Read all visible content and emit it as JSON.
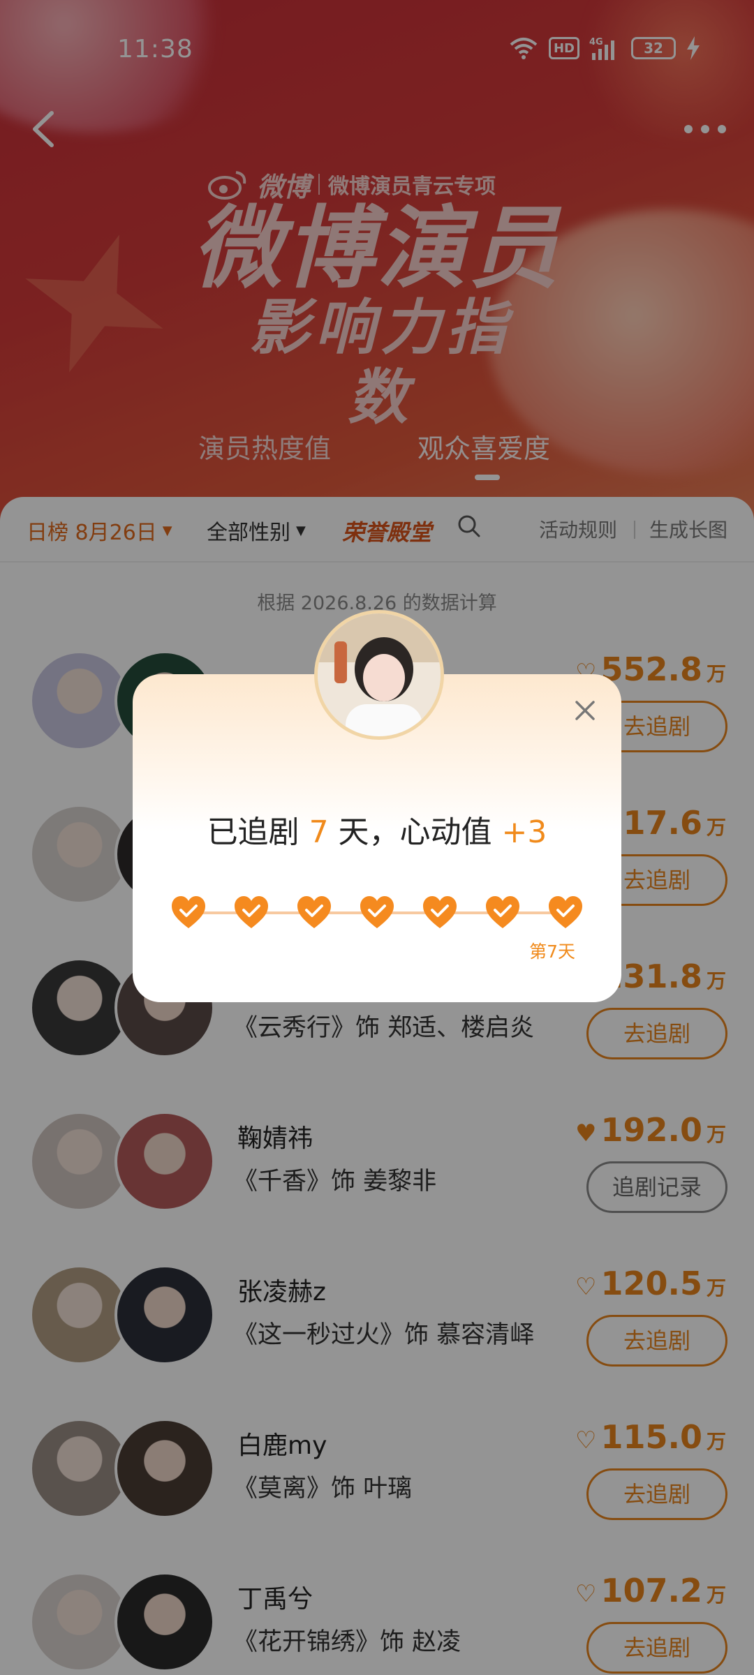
{
  "status_bar": {
    "time": "11:38",
    "network": "4G",
    "hd": "HD",
    "battery": "32"
  },
  "header": {
    "brand_logo": "微博",
    "brand_sub": "微博演员青云专项",
    "title": "微博演员",
    "subtitle": "影响力指数",
    "tabs": [
      "演员热度值",
      "观众喜爱度"
    ],
    "active_tab": 1
  },
  "filters": {
    "date": "日榜 8月26日",
    "gender": "全部性别",
    "hall_of_fame": "荣誉殿堂",
    "rules": "活动规则",
    "generate": "生成长图"
  },
  "calc_note": "根据 2026.8.26 的数据计算",
  "ranking": [
    {
      "name": "",
      "role": "",
      "score": "552.8",
      "unit": "万",
      "action": "去追剧",
      "liked": false
    },
    {
      "name": "",
      "role": "",
      "score": "317.6",
      "unit": "万",
      "action": "去追剧",
      "liked": false
    },
    {
      "name": "",
      "role": "《云秀行》饰 郑适、楼启炎",
      "score": "231.8",
      "unit": "万",
      "action": "去追剧",
      "liked": false
    },
    {
      "name": "鞠婧祎",
      "role": "《千香》饰 姜黎非",
      "score": "192.0",
      "unit": "万",
      "action": "追剧记录",
      "liked": true
    },
    {
      "name": "张凌赫z",
      "role": "《这一秒过火》饰 慕容清峄",
      "score": "120.5",
      "unit": "万",
      "action": "去追剧",
      "liked": false
    },
    {
      "name": "白鹿my",
      "role": "《莫离》饰 叶璃",
      "score": "115.0",
      "unit": "万",
      "action": "去追剧",
      "liked": false
    },
    {
      "name": "丁禹兮",
      "role": "《花开锦绣》饰 赵凌",
      "score": "107.2",
      "unit": "万",
      "action": "去追剧",
      "liked": false
    }
  ],
  "modal": {
    "prefix": "已追剧 ",
    "days": "7",
    "middle": " 天，心动值 ",
    "bonus": "+3",
    "day_label": "第7天",
    "hearts_count": 7
  },
  "colors": {
    "accent": "#e7841d",
    "modal_highlight": "#f08a1b",
    "banner": "#d43a3a"
  }
}
